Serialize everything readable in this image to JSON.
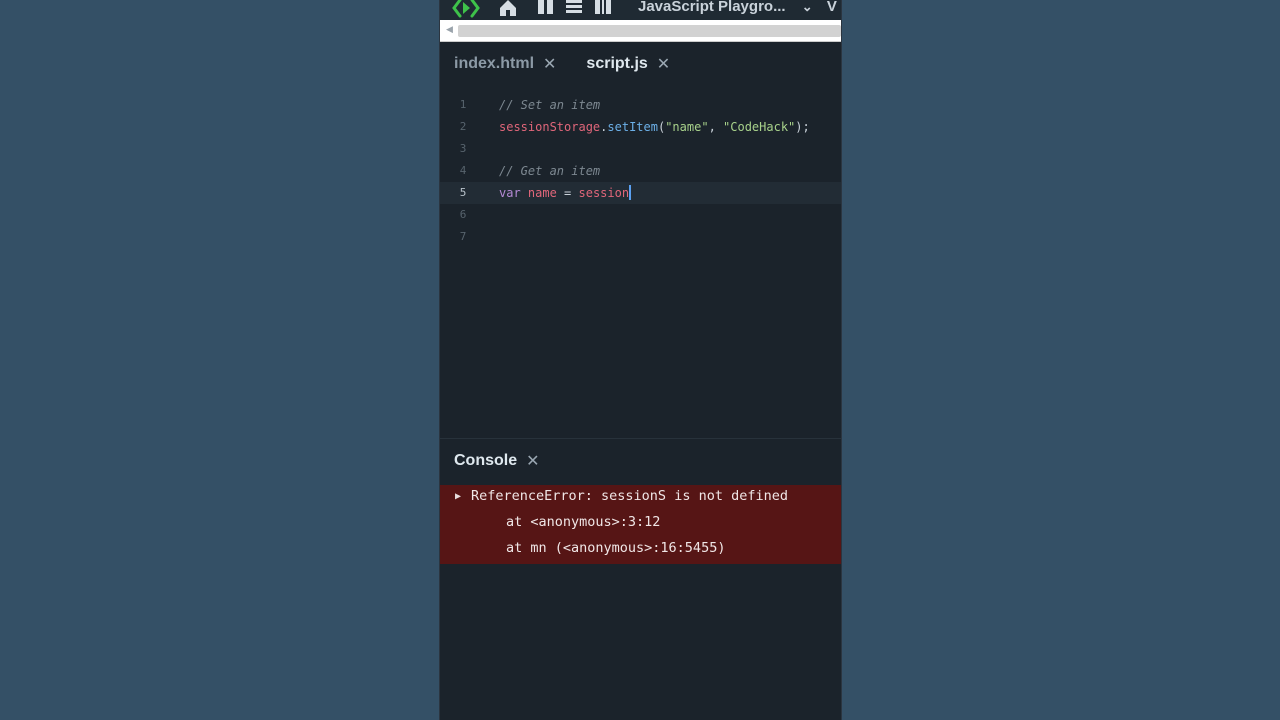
{
  "app": {
    "title": "JavaScript Playgro...",
    "title_chevron": "⌄",
    "title_overflow": "V"
  },
  "tabs": [
    {
      "label": "index.html",
      "close": "✕",
      "active": false
    },
    {
      "label": "script.js",
      "close": "✕",
      "active": true
    }
  ],
  "editor": {
    "lines": [
      {
        "num": "1",
        "comment": "// Set an item"
      },
      {
        "num": "2",
        "obj": "sessionStorage",
        "dot": ".",
        "fn": "setItem",
        "open": "(",
        "arg1": "\"name\"",
        "comma": ", ",
        "arg2": "\"CodeHack\"",
        "close": ");"
      },
      {
        "num": "3"
      },
      {
        "num": "4",
        "comment": "// Get an item"
      },
      {
        "num": "5",
        "kw": "var",
        "ident": " name",
        "eq": " = ",
        "rhs": "session"
      },
      {
        "num": "6"
      },
      {
        "num": "7"
      }
    ],
    "current_line": 5
  },
  "console": {
    "title": "Console",
    "close": "✕",
    "error": {
      "message": "ReferenceError: sessionS is not defined",
      "stack": [
        "at <anonymous>:3:12",
        "at mn (<anonymous>:16:5455)"
      ]
    }
  },
  "colors": {
    "background": "#345066",
    "editor_bg": "#1b232b",
    "error_bg": "#561515",
    "logo_green": "#3ec24a"
  }
}
